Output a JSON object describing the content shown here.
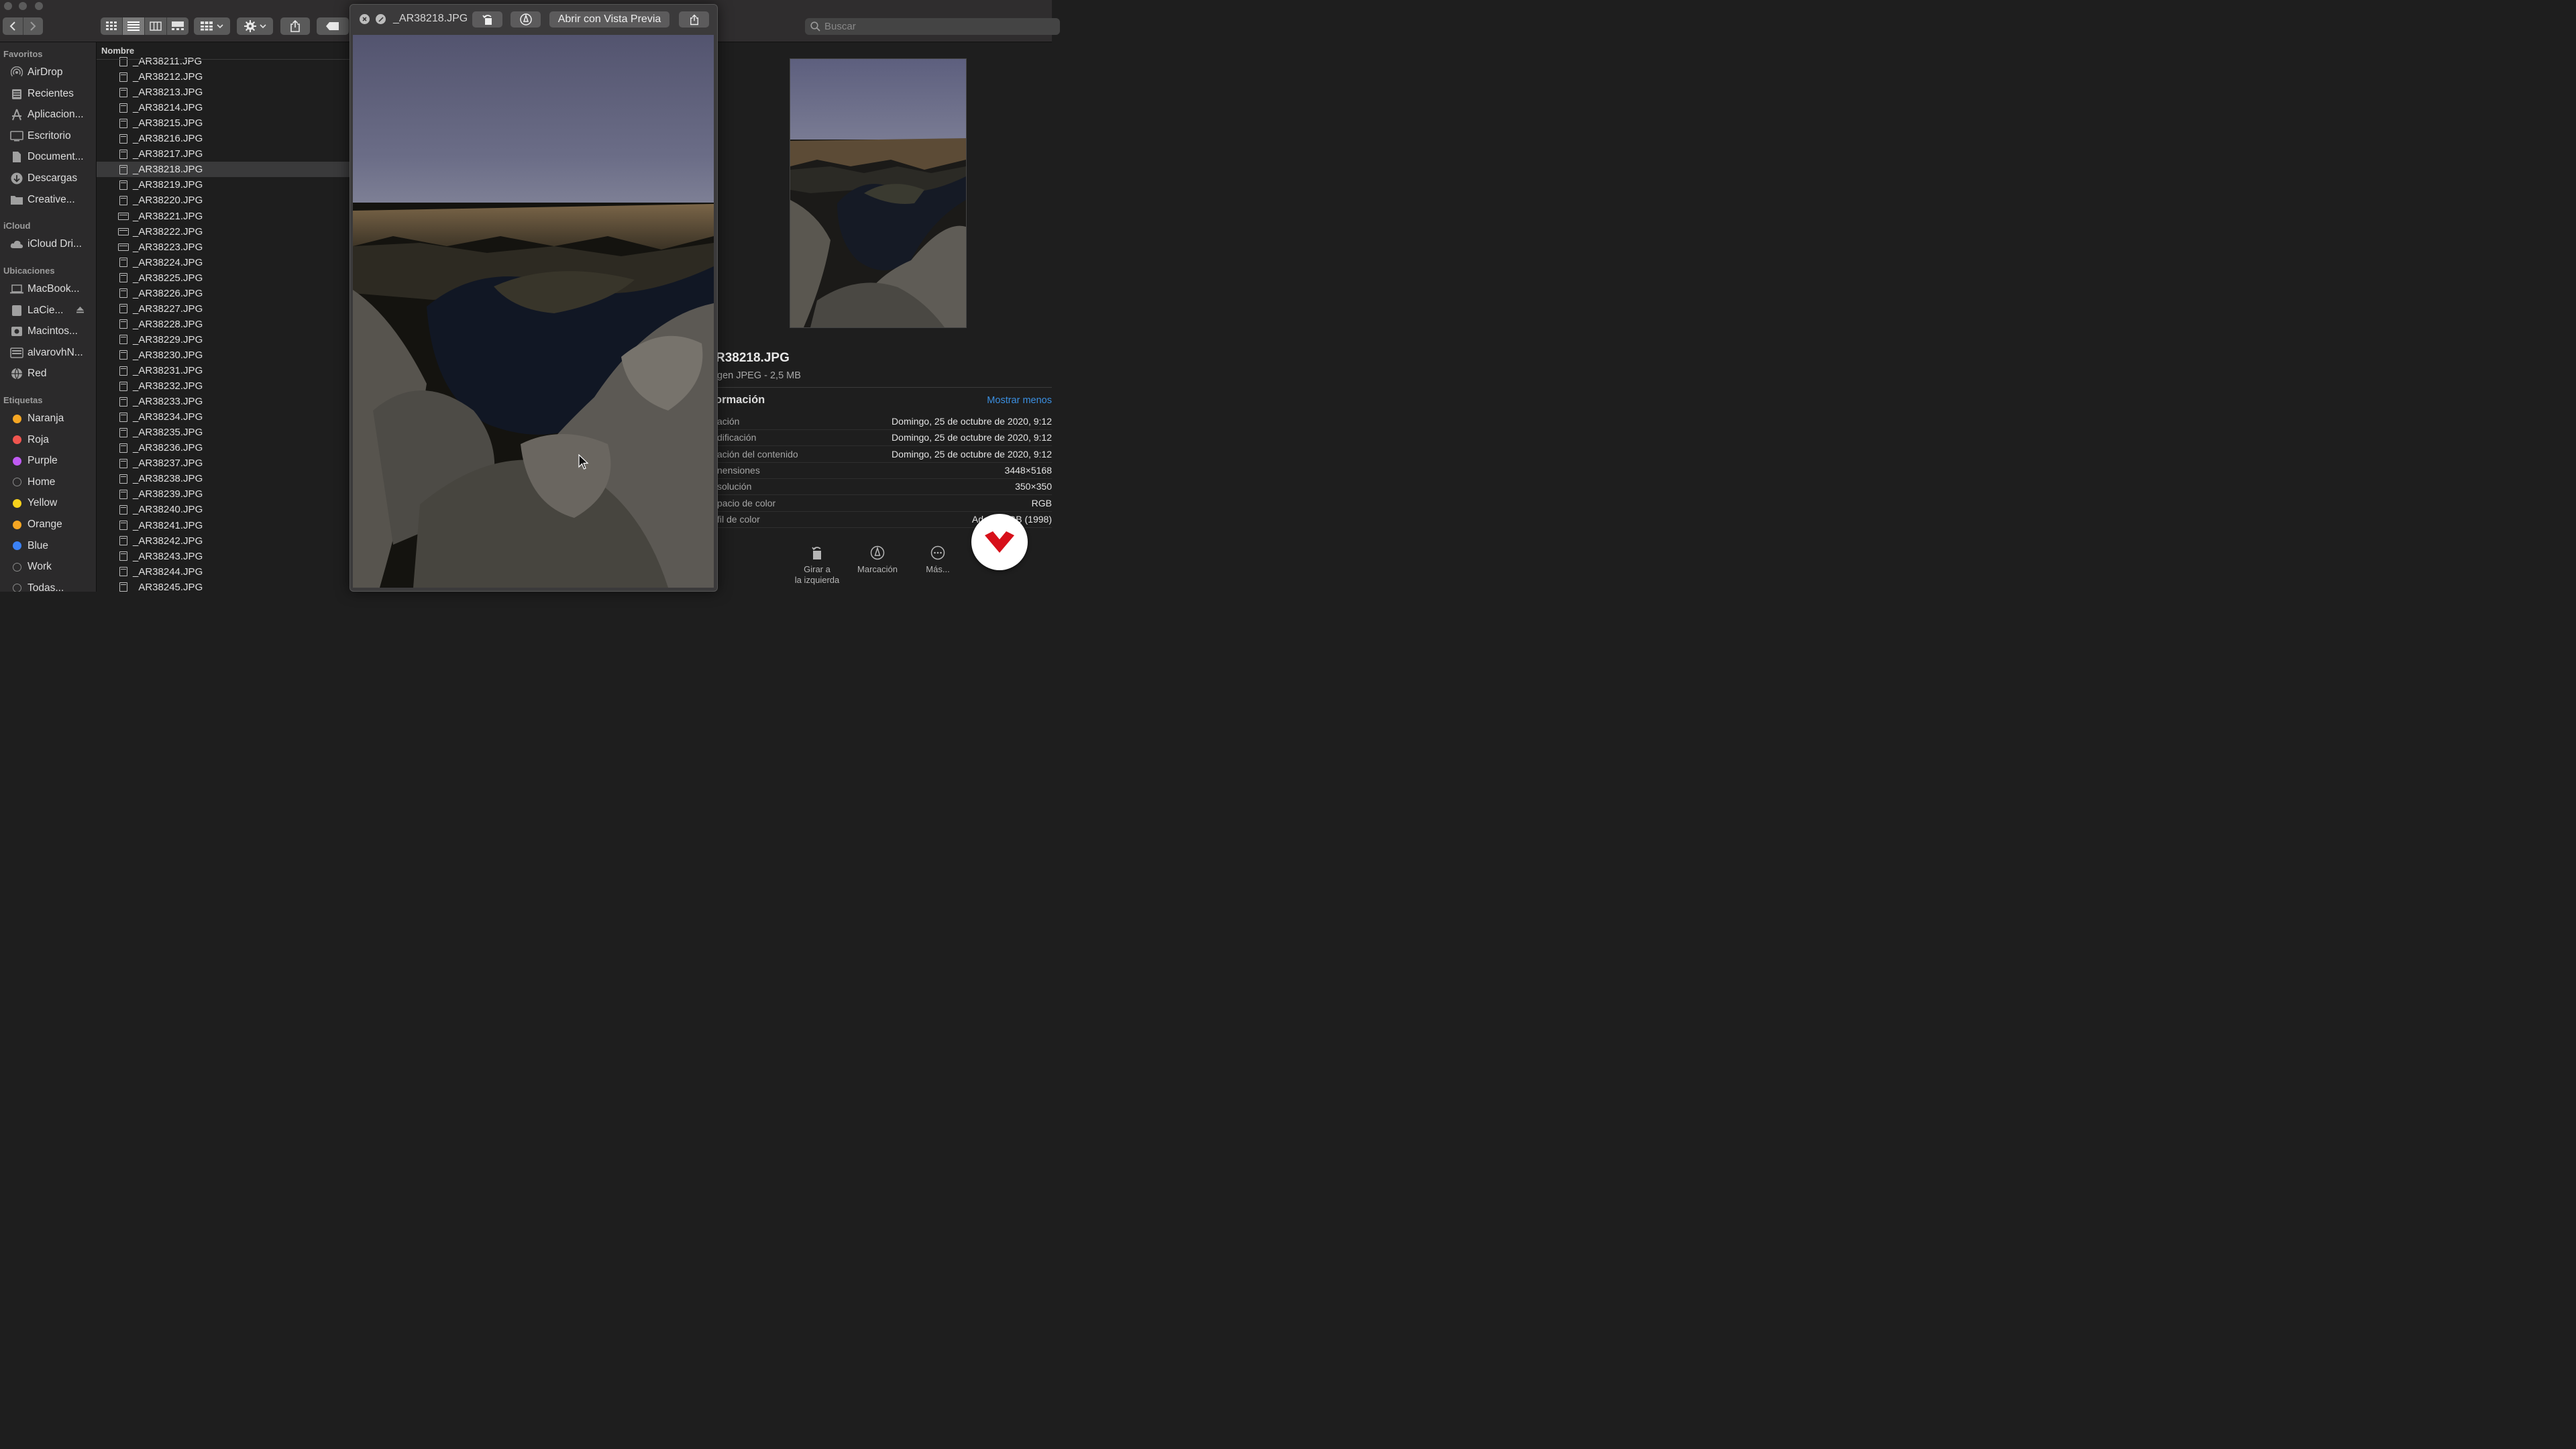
{
  "toolbar": {
    "search_placeholder": "Buscar",
    "share_icon": "share-icon",
    "action_icon": "gear-icon"
  },
  "sidebar": {
    "favorites_title": "Favoritos",
    "favorites": [
      {
        "label": "AirDrop",
        "icon": "airdrop-icon"
      },
      {
        "label": "Recientes",
        "icon": "clock-icon"
      },
      {
        "label": "Aplicacion...",
        "icon": "applications-icon"
      },
      {
        "label": "Escritorio",
        "icon": "desktop-icon"
      },
      {
        "label": "Document...",
        "icon": "document-icon"
      },
      {
        "label": "Descargas",
        "icon": "download-icon"
      },
      {
        "label": "Creative...",
        "icon": "folder-icon"
      }
    ],
    "icloud_title": "iCloud",
    "icloud": [
      {
        "label": "iCloud Dri...",
        "icon": "cloud-icon"
      }
    ],
    "locations_title": "Ubicaciones",
    "locations": [
      {
        "label": "MacBook...",
        "icon": "laptop-icon"
      },
      {
        "label": "LaCie...",
        "icon": "drive-icon"
      },
      {
        "label": "Macintos...",
        "icon": "disk-icon"
      },
      {
        "label": "alvarovhN...",
        "icon": "server-icon"
      },
      {
        "label": "Red",
        "icon": "network-icon"
      }
    ],
    "tags_title": "Etiquetas",
    "tags": [
      {
        "label": "Naranja",
        "color": "#f5a623"
      },
      {
        "label": "Roja",
        "color": "#f0554f"
      },
      {
        "label": "Purple",
        "color": "#bf5af2"
      },
      {
        "label": "Home",
        "color": "none"
      },
      {
        "label": "Yellow",
        "color": "#f7d21c"
      },
      {
        "label": "Orange",
        "color": "#f5a623"
      },
      {
        "label": "Blue",
        "color": "#3b82f6"
      },
      {
        "label": "Work",
        "color": "none"
      },
      {
        "label": "Todas...",
        "color": "none"
      }
    ]
  },
  "filelist": {
    "column_header": "Nombre",
    "selected_index": 7,
    "files": [
      {
        "name": "_AR38211.JPG",
        "orient": "portrait"
      },
      {
        "name": "_AR38212.JPG",
        "orient": "portrait"
      },
      {
        "name": "_AR38213.JPG",
        "orient": "portrait"
      },
      {
        "name": "_AR38214.JPG",
        "orient": "portrait"
      },
      {
        "name": "_AR38215.JPG",
        "orient": "portrait"
      },
      {
        "name": "_AR38216.JPG",
        "orient": "portrait"
      },
      {
        "name": "_AR38217.JPG",
        "orient": "portrait"
      },
      {
        "name": "_AR38218.JPG",
        "orient": "portrait"
      },
      {
        "name": "_AR38219.JPG",
        "orient": "portrait"
      },
      {
        "name": "_AR38220.JPG",
        "orient": "portrait"
      },
      {
        "name": "_AR38221.JPG",
        "orient": "landscape"
      },
      {
        "name": "_AR38222.JPG",
        "orient": "landscape"
      },
      {
        "name": "_AR38223.JPG",
        "orient": "landscape"
      },
      {
        "name": "_AR38224.JPG",
        "orient": "portrait"
      },
      {
        "name": "_AR38225.JPG",
        "orient": "portrait"
      },
      {
        "name": "_AR38226.JPG",
        "orient": "portrait"
      },
      {
        "name": "_AR38227.JPG",
        "orient": "portrait"
      },
      {
        "name": "_AR38228.JPG",
        "orient": "portrait"
      },
      {
        "name": "_AR38229.JPG",
        "orient": "portrait"
      },
      {
        "name": "_AR38230.JPG",
        "orient": "portrait"
      },
      {
        "name": "_AR38231.JPG",
        "orient": "portrait"
      },
      {
        "name": "_AR38232.JPG",
        "orient": "portrait"
      },
      {
        "name": "_AR38233.JPG",
        "orient": "portrait"
      },
      {
        "name": "_AR38234.JPG",
        "orient": "portrait"
      },
      {
        "name": "_AR38235.JPG",
        "orient": "portrait"
      },
      {
        "name": "_AR38236.JPG",
        "orient": "portrait"
      },
      {
        "name": "_AR38237.JPG",
        "orient": "portrait"
      },
      {
        "name": "_AR38238.JPG",
        "orient": "portrait"
      },
      {
        "name": "_AR38239.JPG",
        "orient": "portrait"
      },
      {
        "name": "_AR38240.JPG",
        "orient": "portrait"
      },
      {
        "name": "_AR38241.JPG",
        "orient": "portrait"
      },
      {
        "name": "_AR38242.JPG",
        "orient": "portrait"
      },
      {
        "name": "_AR38243.JPG",
        "orient": "portrait"
      },
      {
        "name": "_AR38244.JPG",
        "orient": "portrait"
      },
      {
        "name": "_AR38245.JPG",
        "orient": "portrait"
      }
    ]
  },
  "quicklook": {
    "title": "_AR38218.JPG",
    "open_with_label": "Abrir con Vista Previa"
  },
  "preview": {
    "file_name": "R38218.JPG",
    "file_kind": "gen JPEG - 2,5 MB",
    "info_title": "ormación",
    "show_less": "Mostrar menos",
    "metadata": [
      {
        "key": "ación",
        "value": "Domingo, 25 de octubre de 2020, 9:12"
      },
      {
        "key": "dificación",
        "value": "Domingo, 25 de octubre de 2020, 9:12"
      },
      {
        "key": "ación del contenido",
        "value": "Domingo, 25 de octubre de 2020, 9:12"
      },
      {
        "key": "nensiones",
        "value": "3448×5168"
      },
      {
        "key": "solución",
        "value": "350×350"
      },
      {
        "key": "pacio de color",
        "value": "RGB"
      },
      {
        "key": "fil de color",
        "value": "Adobe RGB (1998)"
      }
    ],
    "actions": [
      {
        "label1": "Girar a",
        "label2": "la izquierda"
      },
      {
        "label1": "Marcación",
        "label2": ""
      },
      {
        "label1": "Más...",
        "label2": ""
      }
    ]
  }
}
